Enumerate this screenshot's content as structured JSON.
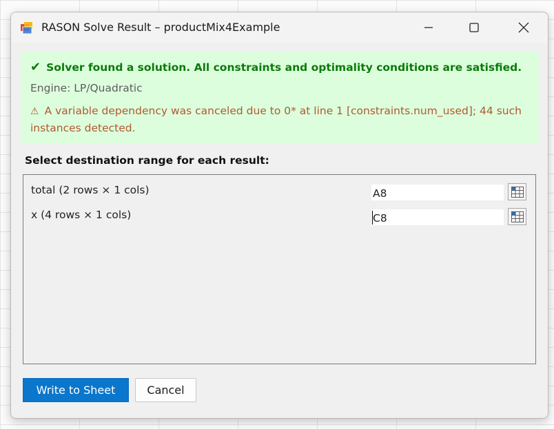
{
  "window": {
    "title": "RASON Solve Result – productMix4Example",
    "icon": "app-window-icon",
    "controls": [
      "minimize-icon",
      "maximize-icon",
      "close-icon"
    ]
  },
  "status": {
    "check_icon": "✔",
    "message": "Solver found a solution.  All constraints and optimality conditions are satisfied.",
    "engine": "Engine: LP/Quadratic",
    "warning_icon": "⚠",
    "warning": "A variable dependency was canceled due to 0* at line 1 [constraints.num_used]; 44 such instances detected.",
    "colors": {
      "panel_bg": "#ddfedd",
      "success_text": "#0b7a0b",
      "warning_text": "#b05a2e"
    }
  },
  "results": {
    "heading": "Select destination range for each result:",
    "rows": [
      {
        "label": "total  (2 rows × 1 cols)",
        "value": "A8",
        "picker_icon": "range-picker-icon"
      },
      {
        "label": "x  (4 rows × 1 cols)",
        "value": "C8",
        "picker_icon": "range-picker-icon"
      }
    ]
  },
  "buttons": {
    "write": "Write to Sheet",
    "cancel": "Cancel",
    "accent": "#0a76cc"
  }
}
